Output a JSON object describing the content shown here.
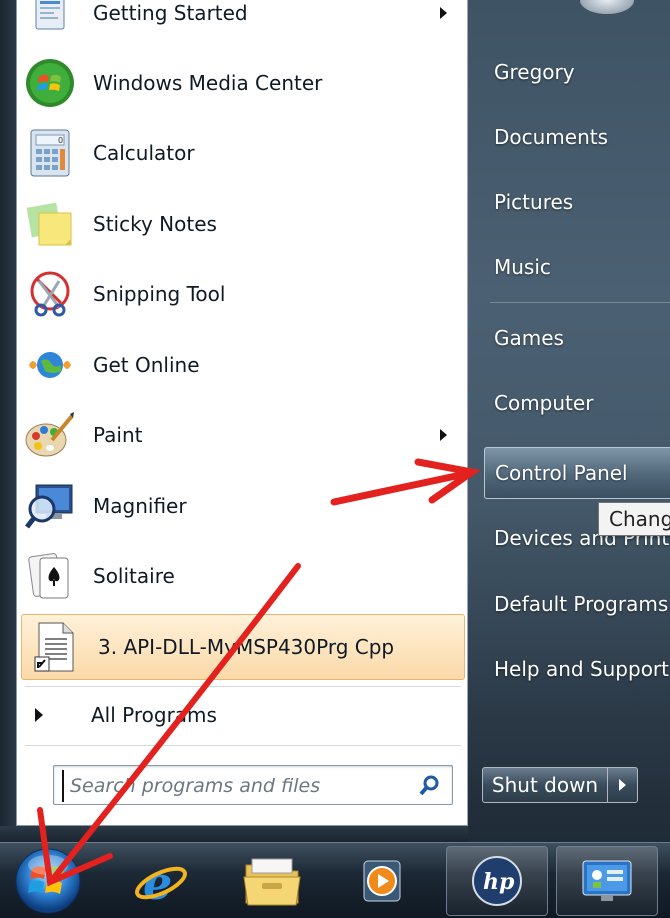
{
  "start_menu": {
    "programs": [
      {
        "label": "Getting Started",
        "icon": "getting-started-icon",
        "has_submenu": true
      },
      {
        "label": "Windows Media Center",
        "icon": "media-center-icon",
        "has_submenu": false
      },
      {
        "label": "Calculator",
        "icon": "calculator-icon",
        "has_submenu": false
      },
      {
        "label": "Sticky Notes",
        "icon": "sticky-notes-icon",
        "has_submenu": false
      },
      {
        "label": "Snipping Tool",
        "icon": "snipping-tool-icon",
        "has_submenu": false
      },
      {
        "label": "Get Online",
        "icon": "globe-icon",
        "has_submenu": false
      },
      {
        "label": "Paint",
        "icon": "paint-icon",
        "has_submenu": true
      },
      {
        "label": "Magnifier",
        "icon": "magnifier-icon",
        "has_submenu": false
      },
      {
        "label": "Solitaire",
        "icon": "solitaire-icon",
        "has_submenu": false
      }
    ],
    "recent_file": {
      "label": "3. API-DLL-MyMSP430Prg Cpp",
      "icon": "document-shortcut-icon"
    },
    "all_programs_label": "All Programs",
    "search": {
      "placeholder": "Search programs and files",
      "icon": "search-icon"
    },
    "places": [
      {
        "label": "Gregory"
      },
      {
        "label": "Documents"
      },
      {
        "label": "Pictures"
      },
      {
        "label": "Music"
      },
      {
        "label": "Games"
      },
      {
        "label": "Computer"
      },
      {
        "label": "Control Panel"
      },
      {
        "label": "Devices and Printers"
      },
      {
        "label": "Default Programs"
      },
      {
        "label": "Help and Support"
      }
    ],
    "tooltip": "Chang",
    "shutdown_label": "Shut down"
  },
  "taskbar": {
    "items": [
      {
        "icon": "windows-start-orb-icon"
      },
      {
        "icon": "internet-explorer-icon"
      },
      {
        "icon": "file-explorer-icon"
      },
      {
        "icon": "media-player-icon"
      },
      {
        "icon": "hp-icon"
      },
      {
        "icon": "control-panel-app-icon"
      }
    ]
  },
  "colors": {
    "annotation_arrow": "#e3211e",
    "highlight": "#fbd9a8"
  }
}
